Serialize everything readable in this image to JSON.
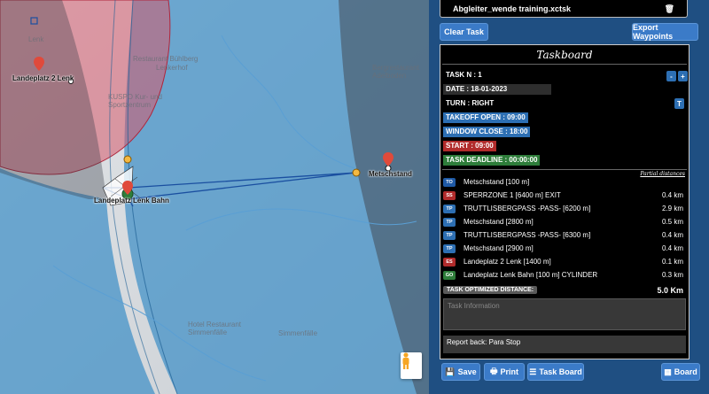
{
  "map": {
    "labels": {
      "lenk": "Lenk",
      "landeplatz2": "Landeplatz 2 Lenk",
      "landeplatz_bahn": "Landeplatz Lenk Bahn",
      "metschstand": "Metschstand",
      "restaurant": "Restaurant Bühlberg",
      "simmenfaelle": "Hotel Restaurant Simmenfälle",
      "simmenfaelle2": "Simmenfälle",
      "bergrestaurant": "Bergrestaurant Adelboden",
      "kuspo": "KUSPO Kur- und Sportzentrum",
      "lenkerhof": "Lenkerhof"
    },
    "colors": {
      "cylinder_red": "#d65a6b",
      "cylinder_blue": "#3e8fc6",
      "start_dark": "#444a55",
      "route": "#1a4fa0"
    },
    "pegman_icon": "pegman-icon"
  },
  "panel": {
    "file_name": "Abgleiter_wende training.xctsk",
    "trash_icon": "trash-icon",
    "clear_task": "Clear Task",
    "export_waypoints": "Export Waypoints",
    "taskboard_title": "Taskboard",
    "task_n": "TASK N : 1",
    "date": "DATE :  18-01-2023",
    "turn": "TURN : RIGHT",
    "turn_btn": "T",
    "minus_btn": "-",
    "plus_btn": "+",
    "takeoff_open": "TAKEOFF OPEN : 09:00",
    "window_close": "WINDOW CLOSE : 18:00",
    "start": "START : 09:00",
    "task_deadline": "TASK DEADLINE : 00:00:00",
    "partial_distances": "Partial distances",
    "waypoints": [
      {
        "type": "TO",
        "color": "#1f5aa6",
        "name": "Metschstand [100 m]",
        "dist": ""
      },
      {
        "type": "SS",
        "color": "#b12b2b",
        "name": "SPERRZONE 1 [6400 m] EXIT",
        "dist": "0.4 km"
      },
      {
        "type": "TP",
        "color": "#2d6fb3",
        "name": "TRUTTLISBERGPASS -PASS- [6200 m]",
        "dist": "2.9 km"
      },
      {
        "type": "TP",
        "color": "#2d6fb3",
        "name": "Metschstand [2800 m]",
        "dist": "0.5 km"
      },
      {
        "type": "TP",
        "color": "#2d6fb3",
        "name": "TRUTTLISBERGPASS -PASS- [6300 m]",
        "dist": "0.4 km"
      },
      {
        "type": "TP",
        "color": "#2d6fb3",
        "name": "Metschstand [2900 m]",
        "dist": "0.4 km"
      },
      {
        "type": "ES",
        "color": "#b12b2b",
        "name": "Landeplatz 2 Lenk [1400 m]",
        "dist": "0.1 km"
      },
      {
        "type": "GO",
        "color": "#2e7d3a",
        "name": "Landeplatz Lenk Bahn [100 m] CYLINDER",
        "dist": "0.3 km"
      }
    ],
    "optimized_label": "TASK OPTIMIZED DISTANCE:",
    "optimized_value": "5.0 Km",
    "task_info_placeholder": "Task Information",
    "report_back": "Report back: Para Stop",
    "save": "Save",
    "print": "Print",
    "task_board": "Task Board",
    "board": "Board"
  }
}
